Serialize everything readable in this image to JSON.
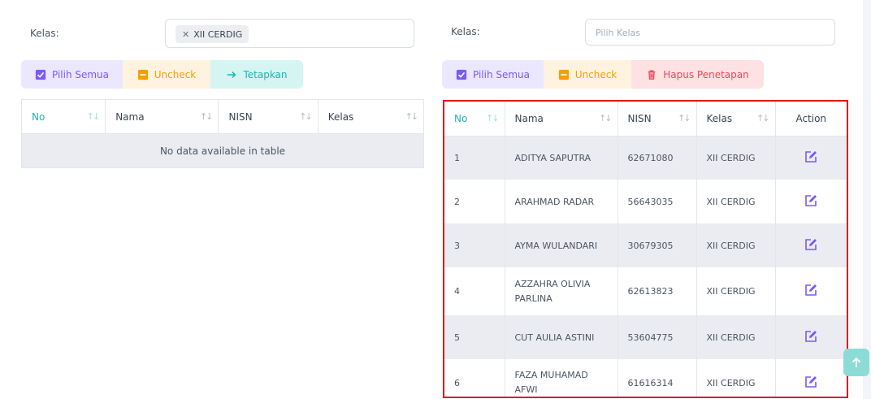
{
  "left_panel": {
    "kelas_label": "Kelas:",
    "selected_chip": "XII CERDIG",
    "buttons": {
      "pilih_semua": "Pilih Semua",
      "uncheck": "Uncheck",
      "tetapkan": "Tetapkan"
    },
    "table": {
      "headers": [
        "No",
        "Nama",
        "NISN",
        "Kelas"
      ],
      "empty_message": "No data available in table"
    }
  },
  "right_panel": {
    "kelas_label": "Kelas:",
    "placeholder": "Pilih Kelas",
    "buttons": {
      "pilih_semua": "Pilih Semua",
      "uncheck": "Uncheck",
      "hapus_penetapan": "Hapus Penetapan"
    },
    "table": {
      "headers": [
        "No",
        "Nama",
        "NISN",
        "Kelas",
        "Action"
      ],
      "rows": [
        {
          "no": "1",
          "nama": "ADITYA SAPUTRA",
          "nisn": "62671080",
          "kelas": "XII CERDIG"
        },
        {
          "no": "2",
          "nama": "ARAHMAD RADAR",
          "nisn": "56643035",
          "kelas": "XII CERDIG"
        },
        {
          "no": "3",
          "nama": "AYMA WULANDARI",
          "nisn": "30679305",
          "kelas": "XII CERDIG"
        },
        {
          "no": "4",
          "nama": "AZZAHRA OLIVIA PARLINA",
          "nisn": "62613823",
          "kelas": "XII CERDIG"
        },
        {
          "no": "5",
          "nama": "CUT AULIA ASTINI",
          "nisn": "53604775",
          "kelas": "XII CERDIG"
        },
        {
          "no": "6",
          "nama": "FAZA MUHAMAD AFWI",
          "nisn": "61616314",
          "kelas": "XII CERDIG"
        }
      ]
    }
  },
  "colors": {
    "accent_purple": "#7a5af8",
    "accent_teal": "#1fb5ad",
    "accent_orange": "#f59f00",
    "accent_red": "#e84b5b",
    "highlight_border": "#e2151b"
  },
  "icons": {
    "checkbox": "checkbox-checked-icon",
    "uncheck": "minus-square-icon",
    "tetapkan": "arrow-right-icon",
    "hapus": "trash-icon",
    "edit": "edit-icon",
    "scroll_top": "arrow-up-icon",
    "remove_chip": "close-icon"
  }
}
